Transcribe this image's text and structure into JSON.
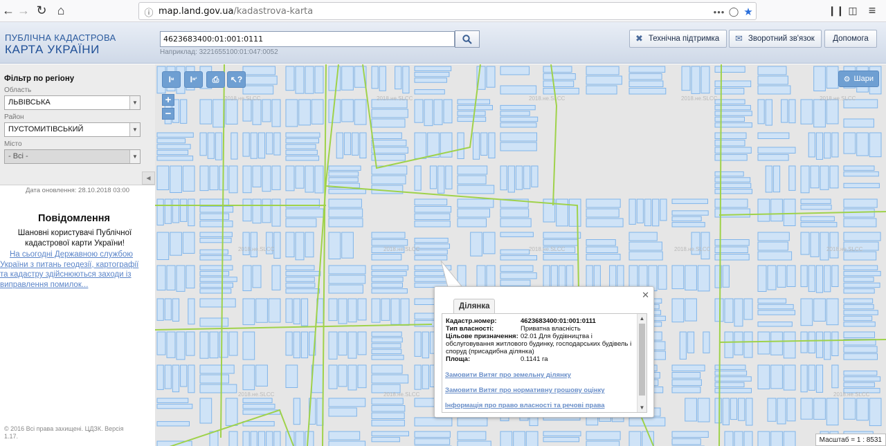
{
  "browser": {
    "url_host": "map.land.gov.ua",
    "url_path": "/kadastrova-karta"
  },
  "header": {
    "logo_line1": "ПУБЛІЧНА КАДАСТРОВА",
    "logo_line2": "КАРТА УКРАЇНИ",
    "search_value": "4623683400:01:001:0111",
    "search_hint": "Наприклад: 3221655100:01:047:0052",
    "buttons": {
      "support": "Технічна підтримка",
      "feedback": "Зворотний зв'язок",
      "help": "Допомога"
    }
  },
  "sidebar": {
    "filter_title": "Фільтр по регіону",
    "region_label": "Область",
    "region_value": "ЛЬВІВСЬКА",
    "district_label": "Район",
    "district_value": "ПУСТОМИТІВСЬКИЙ",
    "city_label": "Місто",
    "city_value": "- Всі -",
    "update_date": "Дата оновлення: 28.10.2018 03:00",
    "notice_title": "Повідомлення",
    "notice_text": "Шановні користувачі Публічної кадастрової карти України!",
    "notice_link_lines": [
      "На сьогодні Державною службою",
      "України з питань геодезії, картографії",
      "та кадастру здійснюються заходи із",
      "виправлення помилок..."
    ],
    "copyright": "© 2016 Всі права захищені. ЦДЗК. Версія 1.17."
  },
  "map": {
    "layers_label": "Шари",
    "scale_text": "Масштаб = 1 : 8531",
    "watermark": "2018.не.SLCC",
    "tools": [
      "Iм",
      "Iмр",
      "print",
      "info"
    ],
    "colors": {
      "background": "#e6e6e6",
      "parcel_fill": "#cfe3f7",
      "parcel_stroke": "#7fb4ea",
      "boundary": "#9fd24a"
    }
  },
  "popup": {
    "tab": "Ділянка",
    "rows": [
      {
        "label": "Кадастр.номер:",
        "value": "4623683400:01:001:0111",
        "bold": true
      },
      {
        "label": "Тип власності:",
        "value": "Приватна власність"
      },
      {
        "label": "Цільове призначення:",
        "value_lines": [
          "02.01 Для будівництва і",
          "обслуговування житлового будинку, господарських будівель і",
          "споруд (присадибна ділянка)"
        ]
      },
      {
        "label": "Площа:",
        "value": "0.1141 га"
      }
    ],
    "links": [
      "Замовити Витяг про земельну ділянку",
      "Замовити Витяг про нормативну грошову оцінку",
      "Інформація про право власності та речові права"
    ]
  }
}
